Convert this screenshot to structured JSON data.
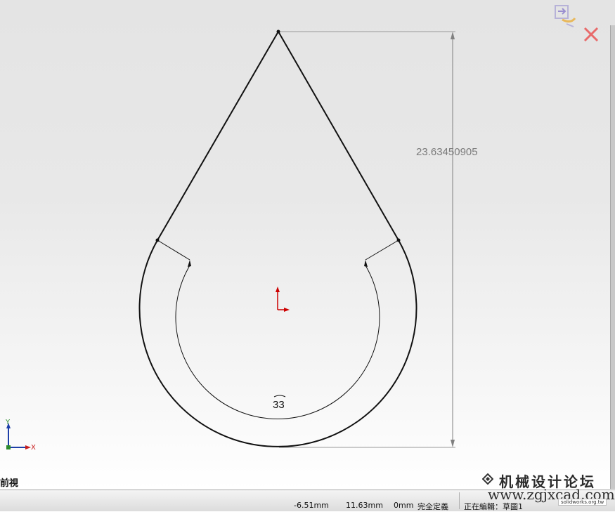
{
  "sketch": {
    "dimension_linear": "23.63450905",
    "dimension_radial": "33"
  },
  "triad": {
    "y_label": "Y",
    "x_label": "X"
  },
  "view": {
    "label": "前視"
  },
  "status": {
    "x": "-6.51mm",
    "y": "11.63mm",
    "z": "0mm",
    "definition": "完全定義",
    "editing": "正在編輯：草圖1"
  },
  "watermark": {
    "title": "机械设计论坛",
    "url": "www.zgjxcad.com",
    "badge": "solidworks.org.tw"
  },
  "colors": {
    "sketch_line": "#111111",
    "dimension_line": "#808080",
    "origin": "#cc0000",
    "triad_axis": "#1e3fa8",
    "triad_y": "#2e8b2e",
    "triad_x": "#c81e1e"
  }
}
